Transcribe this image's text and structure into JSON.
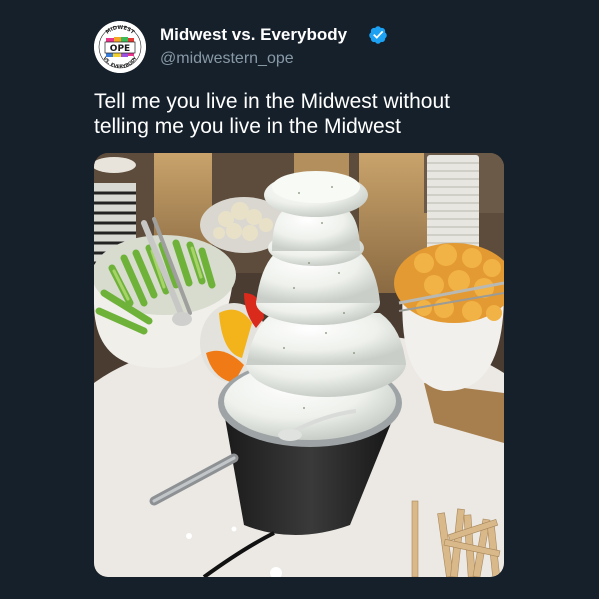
{
  "tweet": {
    "display_name": "Midwest vs. Everybody",
    "handle": "@midwestern_ope",
    "text_line1": "Tell me you live in the Midwest without",
    "text_line2": "telling me you live in the Midwest",
    "verified": true,
    "avatar": {
      "badge_text": "OPE",
      "ring_top_text": "MIDWEST",
      "ring_bottom_text": "VS. EVERYBODY"
    }
  },
  "colors": {
    "background": "#15202b",
    "name_text": "#ffffff",
    "handle_text": "#8899a6",
    "verified_blue": "#1da1f2"
  },
  "icons": {
    "verified": "verified-badge-icon"
  },
  "media": {
    "description_alt": ""
  }
}
